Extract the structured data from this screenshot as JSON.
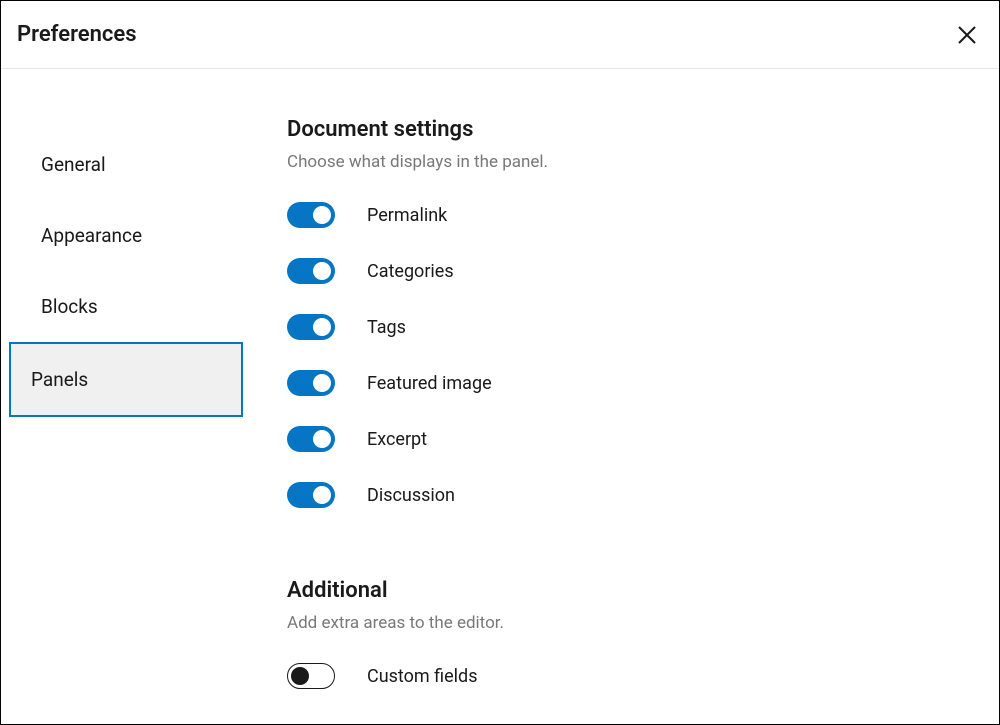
{
  "header": {
    "title": "Preferences"
  },
  "sidebar": {
    "tabs": [
      {
        "label": "General",
        "active": false
      },
      {
        "label": "Appearance",
        "active": false
      },
      {
        "label": "Blocks",
        "active": false
      },
      {
        "label": "Panels",
        "active": true
      }
    ]
  },
  "sections": {
    "document": {
      "title": "Document settings",
      "desc": "Choose what displays in the panel.",
      "toggles": [
        {
          "label": "Permalink",
          "on": true
        },
        {
          "label": "Categories",
          "on": true
        },
        {
          "label": "Tags",
          "on": true
        },
        {
          "label": "Featured image",
          "on": true
        },
        {
          "label": "Excerpt",
          "on": true
        },
        {
          "label": "Discussion",
          "on": true
        }
      ]
    },
    "additional": {
      "title": "Additional",
      "desc": "Add extra areas to the editor.",
      "toggles": [
        {
          "label": "Custom fields",
          "on": false
        }
      ]
    }
  }
}
